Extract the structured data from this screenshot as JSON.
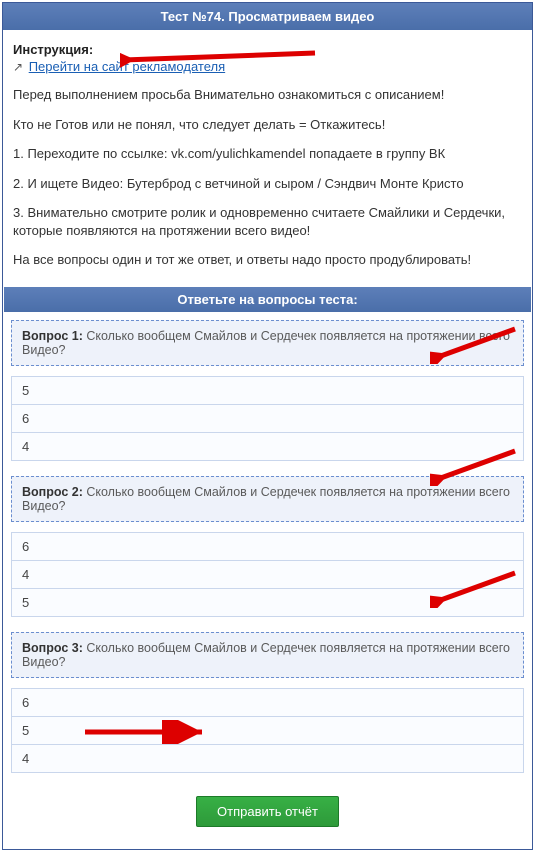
{
  "header": {
    "title": "Тест №74. Просматриваем видео"
  },
  "instruction": {
    "label": "Инструкция:",
    "link_text": "Перейти на сайт рекламодателя",
    "paragraphs": [
      "Перед выполнением просьба Внимательно ознакомиться с описанием!",
      "Кто не Готов или не понял, что следует делать = Откажитесь!",
      "1. Переходите по ссылке: vk.com/yulichkamendel попадаете в группу ВК",
      "2. И ищете Видео: Бутерброд с ветчиной и сыром / Сэндвич Монте Кристо",
      "3. Внимательно смотрите ролик и одновременно считаете Смайлики и Сердечки, которые появляются на протяжении всего видео!",
      "На все вопросы один и тот же ответ, и ответы надо просто продублировать!"
    ]
  },
  "qa_header": "Ответьте на вопросы теста:",
  "questions": [
    {
      "label": "Вопрос 1:",
      "text": "Сколько вообщем Смайлов и Сердечек появляется на протяжении всего Видео?",
      "answers": [
        "5",
        "6",
        "4"
      ]
    },
    {
      "label": "Вопрос 2:",
      "text": "Сколько вообщем Смайлов и Сердечек появляется на протяжении всего Видео?",
      "answers": [
        "6",
        "4",
        "5"
      ]
    },
    {
      "label": "Вопрос 3:",
      "text": "Сколько вообщем Смайлов и Сердечек появляется на протяжении всего Видео?",
      "answers": [
        "6",
        "5",
        "4"
      ]
    }
  ],
  "submit_label": "Отправить отчёт"
}
